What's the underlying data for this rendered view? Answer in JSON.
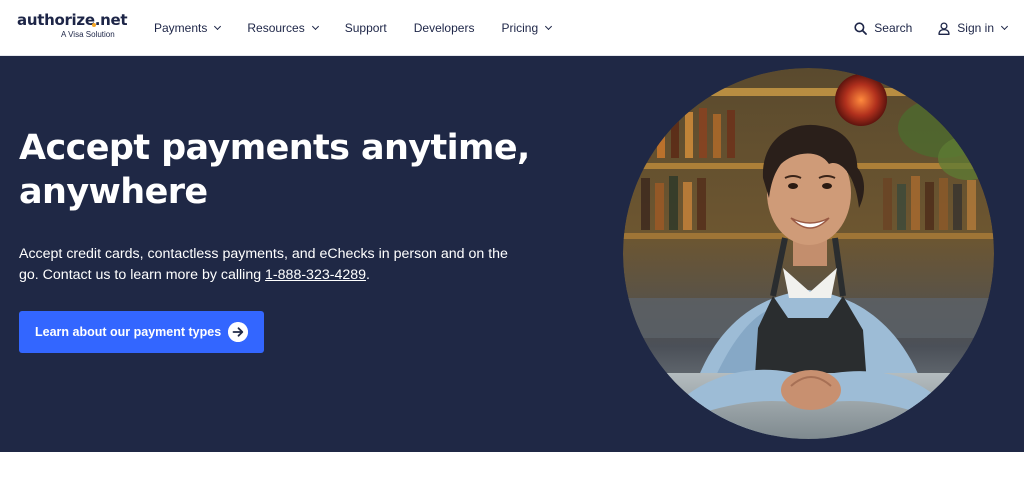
{
  "brand": {
    "name": "authorize.net",
    "tagline": "A Visa Solution"
  },
  "nav": {
    "items": [
      {
        "label": "Payments",
        "has_dropdown": true
      },
      {
        "label": "Resources",
        "has_dropdown": true
      },
      {
        "label": "Support",
        "has_dropdown": false
      },
      {
        "label": "Developers",
        "has_dropdown": false
      },
      {
        "label": "Pricing",
        "has_dropdown": true
      }
    ],
    "search_label": "Search",
    "signin_label": "Sign in"
  },
  "hero": {
    "title_line1": "Accept payments anytime,",
    "title_line2": "anywhere",
    "desc_before": "Accept credit cards, contactless payments, and eChecks in person and on the go. Contact us to learn more by calling ",
    "phone": "1-888-323-4289",
    "desc_after": ".",
    "cta_label": "Learn about our payment types"
  },
  "colors": {
    "hero_bg": "#1f2845",
    "cta_bg": "#3366ff",
    "brand_accent": "#f5a623",
    "text_dark": "#1d2547"
  },
  "icons": {
    "search": "search-icon",
    "user": "user-icon",
    "chevron": "chevron-down-icon",
    "arrow": "arrow-right-icon"
  }
}
